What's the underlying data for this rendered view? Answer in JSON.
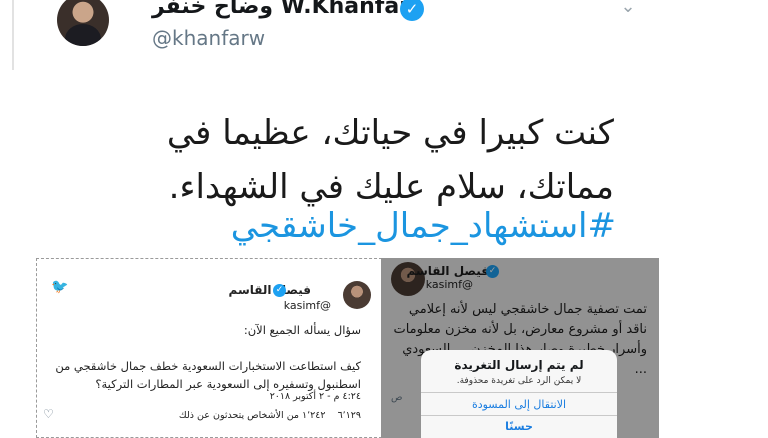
{
  "tweet": {
    "display_name": "وضاح خنفر W.Khanfar",
    "handle": "@khanfarw",
    "text": "كنت كبيرا في حياتك، عظيما في مماتك، سلام عليك في الشهداء.",
    "hashtag": "#استشهاد_جمال_خاشقجي",
    "icons": {
      "verified": "verified-badge-icon",
      "menu": "chevron-down-icon"
    }
  },
  "embed_left": {
    "name": "فيصل القاسم",
    "handle": "@kasimf",
    "question": "سؤال يسأله الجميع الآن:",
    "body": "كيف استطاعت الاستخبارات السعودية خطف جمال خاشقجي من اسطنبول وتسفيره إلى السعودية عبر المطارات التركية؟",
    "time": "٤:٢٤ م - ٢ أكتوبر ٢٠١٨",
    "stats": "١٬٢٤٢ من الأشخاص يتحدثون عن ذلك",
    "likes": "٦٬١٢٩",
    "icons": {
      "brand": "twitter-bird-icon",
      "like": "heart-icon"
    }
  },
  "embed_right": {
    "name": "فيصل القاسم",
    "handle": "@kasimf",
    "body": "تمت تصفية جمال خاشقجي ليس لأنه إعلامي ناقد أو مشروع معارض، بل لأنه مخزن معلومات وأسرار خطيرة وصار هذا المخزن ... السعودي ...",
    "time": "ص",
    "dialog": {
      "title": "لم يتم إرسال التغريدة",
      "message": "لا يمكن الرد على تغريدة محذوفة.",
      "drafts_button": "الانتقال إلى المسودة",
      "ok_button": "حسنًا"
    }
  },
  "colors": {
    "link": "#1b95e0",
    "verified": "#1da1f2",
    "dialog_action": "#1a7de0"
  }
}
